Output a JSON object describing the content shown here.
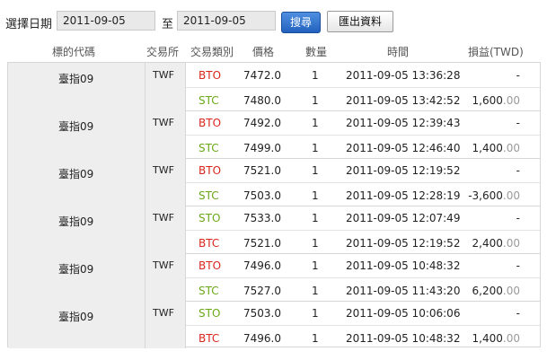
{
  "toolbar": {
    "date_label": "選擇日期",
    "start_date": "2011-09-05",
    "to_label": "至",
    "end_date": "2011-09-05",
    "search_label": "搜尋",
    "export_label": "匯出資料"
  },
  "headers": {
    "symbol": "標的代碼",
    "exchange": "交易所",
    "type": "交易類別",
    "price": "價格",
    "qty": "數量",
    "time": "時間",
    "pnl": "損益(TWD)"
  },
  "colors": {
    "open_red": "#d9261c",
    "close_green": "#6aa816",
    "search_button": "#2262bf"
  },
  "groups": [
    {
      "symbol": "臺指09",
      "exchange": "TWF",
      "trades": [
        {
          "type": "BTO",
          "price": "7472.0",
          "qty": "1",
          "time": "2011-09-05 13:36:28",
          "pnl_int": "-",
          "pnl_dec": ""
        },
        {
          "type": "STC",
          "price": "7480.0",
          "qty": "1",
          "time": "2011-09-05 13:42:52",
          "pnl_int": "1,600",
          "pnl_dec": ".00"
        }
      ]
    },
    {
      "symbol": "臺指09",
      "exchange": "TWF",
      "trades": [
        {
          "type": "BTO",
          "price": "7492.0",
          "qty": "1",
          "time": "2011-09-05 12:39:43",
          "pnl_int": "-",
          "pnl_dec": ""
        },
        {
          "type": "STC",
          "price": "7499.0",
          "qty": "1",
          "time": "2011-09-05 12:46:40",
          "pnl_int": "1,400",
          "pnl_dec": ".00"
        }
      ]
    },
    {
      "symbol": "臺指09",
      "exchange": "TWF",
      "trades": [
        {
          "type": "BTO",
          "price": "7521.0",
          "qty": "1",
          "time": "2011-09-05 12:19:52",
          "pnl_int": "-",
          "pnl_dec": ""
        },
        {
          "type": "STC",
          "price": "7503.0",
          "qty": "1",
          "time": "2011-09-05 12:28:19",
          "pnl_int": "-3,600",
          "pnl_dec": ".00"
        }
      ]
    },
    {
      "symbol": "臺指09",
      "exchange": "TWF",
      "trades": [
        {
          "type": "STO",
          "price": "7533.0",
          "qty": "1",
          "time": "2011-09-05 12:07:49",
          "pnl_int": "-",
          "pnl_dec": ""
        },
        {
          "type": "BTC",
          "price": "7521.0",
          "qty": "1",
          "time": "2011-09-05 12:19:52",
          "pnl_int": "2,400",
          "pnl_dec": ".00"
        }
      ]
    },
    {
      "symbol": "臺指09",
      "exchange": "TWF",
      "trades": [
        {
          "type": "BTO",
          "price": "7496.0",
          "qty": "1",
          "time": "2011-09-05 10:48:32",
          "pnl_int": "-",
          "pnl_dec": ""
        },
        {
          "type": "STC",
          "price": "7527.0",
          "qty": "1",
          "time": "2011-09-05 11:43:20",
          "pnl_int": "6,200",
          "pnl_dec": ".00"
        }
      ]
    },
    {
      "symbol": "臺指09",
      "exchange": "TWF",
      "trades": [
        {
          "type": "STO",
          "price": "7503.0",
          "qty": "1",
          "time": "2011-09-05 10:06:06",
          "pnl_int": "-",
          "pnl_dec": ""
        },
        {
          "type": "BTC",
          "price": "7496.0",
          "qty": "1",
          "time": "2011-09-05 10:48:32",
          "pnl_int": "1,400",
          "pnl_dec": ".00"
        }
      ]
    }
  ]
}
